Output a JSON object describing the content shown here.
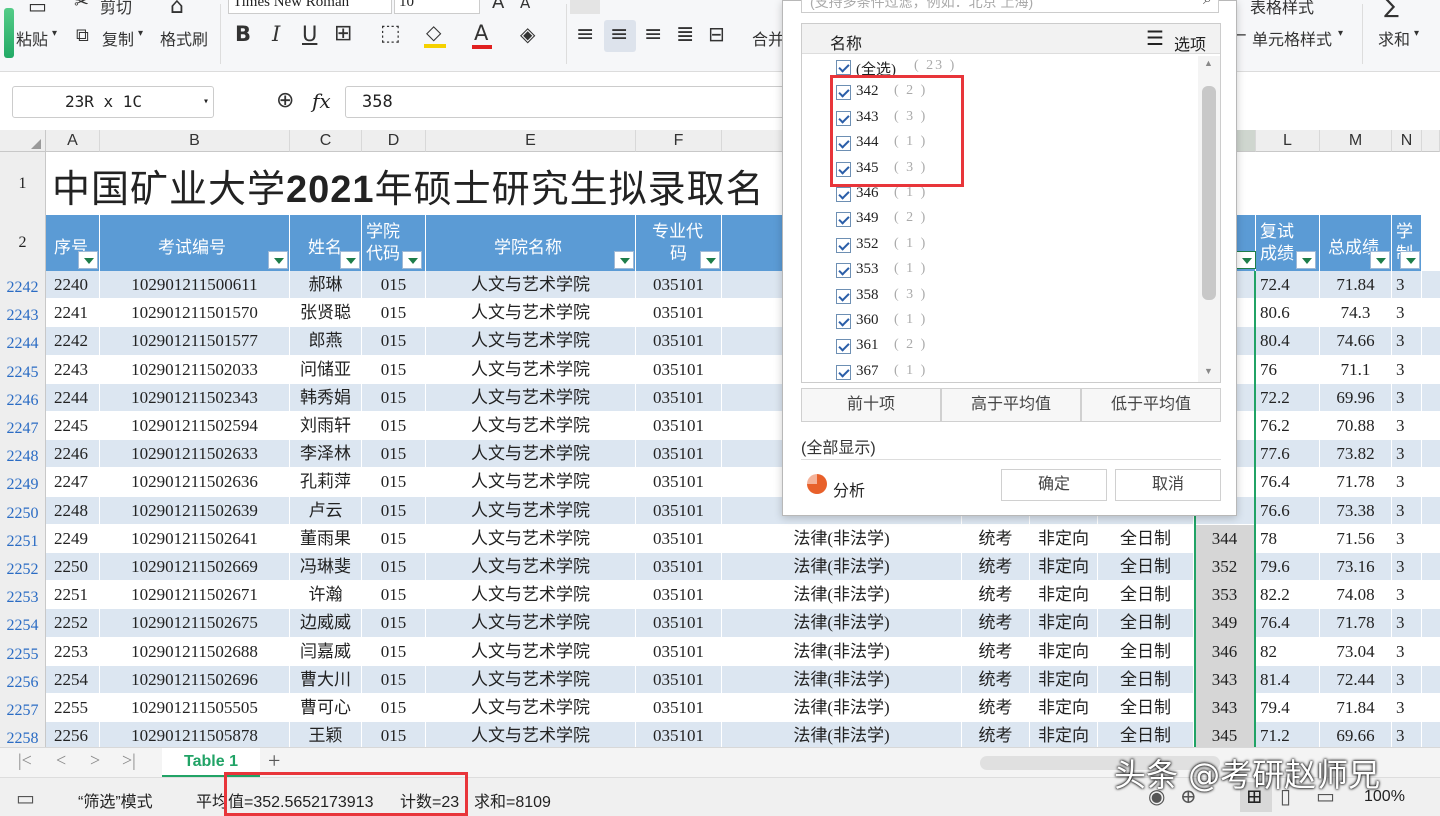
{
  "toolbar": {
    "cut": "剪切",
    "paste": "粘贴",
    "copy": "复制",
    "format_painter": "格式刷",
    "font_name": "Times New Roman",
    "font_size": "10",
    "merge": "合并",
    "table_style": "表格样式",
    "cell_style": "单元格样式",
    "sum": "求和"
  },
  "formula_bar": {
    "name_box": "23R x 1C",
    "fx": "fx",
    "value": "358"
  },
  "columns": [
    "A",
    "B",
    "C",
    "D",
    "E",
    "F",
    "L",
    "M",
    "N"
  ],
  "title": "中国矿业大学2021年硕士研究生拟录取名",
  "title_bold_year": "2021",
  "headers": {
    "seq": "序号",
    "exam_no": "考试编号",
    "name": "姓名",
    "college_code_1": "学院",
    "college_code_2": "代码",
    "college_name": "学院名称",
    "major_code_1": "专业代",
    "major_code_2": "码",
    "retest_1": "复试",
    "retest_2": "成绩",
    "total": "总成绩",
    "xuezhi_1": "学",
    "xuezhi_2": "制"
  },
  "rows": [
    {
      "row": "2242",
      "seq": "2240",
      "exam": "102901211500611",
      "name": "郝琳",
      "code": "015",
      "college": "人文与艺术学院",
      "major": "035101",
      "major_name": "",
      "type": "",
      "dir": "",
      "mode": "",
      "score": "",
      "retest": "72.4",
      "total": "71.84",
      "xz": "3"
    },
    {
      "row": "2243",
      "seq": "2241",
      "exam": "102901211501570",
      "name": "张贤聪",
      "code": "015",
      "college": "人文与艺术学院",
      "major": "035101",
      "major_name": "",
      "type": "",
      "dir": "",
      "mode": "",
      "score": "",
      "retest": "80.6",
      "total": "74.3",
      "xz": "3"
    },
    {
      "row": "2244",
      "seq": "2242",
      "exam": "102901211501577",
      "name": "郎燕",
      "code": "015",
      "college": "人文与艺术学院",
      "major": "035101",
      "major_name": "",
      "type": "",
      "dir": "",
      "mode": "",
      "score": "",
      "retest": "80.4",
      "total": "74.66",
      "xz": "3"
    },
    {
      "row": "2245",
      "seq": "2243",
      "exam": "102901211502033",
      "name": "问储亚",
      "code": "015",
      "college": "人文与艺术学院",
      "major": "035101",
      "major_name": "",
      "type": "",
      "dir": "",
      "mode": "",
      "score": "",
      "retest": "76",
      "total": "71.1",
      "xz": "3"
    },
    {
      "row": "2246",
      "seq": "2244",
      "exam": "102901211502343",
      "name": "韩秀娟",
      "code": "015",
      "college": "人文与艺术学院",
      "major": "035101",
      "major_name": "",
      "type": "",
      "dir": "",
      "mode": "",
      "score": "",
      "retest": "72.2",
      "total": "69.96",
      "xz": "3"
    },
    {
      "row": "2247",
      "seq": "2245",
      "exam": "102901211502594",
      "name": "刘雨轩",
      "code": "015",
      "college": "人文与艺术学院",
      "major": "035101",
      "major_name": "",
      "type": "",
      "dir": "",
      "mode": "",
      "score": "",
      "retest": "76.2",
      "total": "70.88",
      "xz": "3"
    },
    {
      "row": "2248",
      "seq": "2246",
      "exam": "102901211502633",
      "name": "李泽林",
      "code": "015",
      "college": "人文与艺术学院",
      "major": "035101",
      "major_name": "",
      "type": "",
      "dir": "",
      "mode": "",
      "score": "",
      "retest": "77.6",
      "total": "73.82",
      "xz": "3"
    },
    {
      "row": "2249",
      "seq": "2247",
      "exam": "102901211502636",
      "name": "孔莉萍",
      "code": "015",
      "college": "人文与艺术学院",
      "major": "035101",
      "major_name": "",
      "type": "",
      "dir": "",
      "mode": "",
      "score": "",
      "retest": "76.4",
      "total": "71.78",
      "xz": "3"
    },
    {
      "row": "2250",
      "seq": "2248",
      "exam": "102901211502639",
      "name": "卢云",
      "code": "015",
      "college": "人文与艺术学院",
      "major": "035101",
      "major_name": "",
      "type": "",
      "dir": "",
      "mode": "",
      "score": "",
      "retest": "76.6",
      "total": "73.38",
      "xz": "3"
    },
    {
      "row": "2251",
      "seq": "2249",
      "exam": "102901211502641",
      "name": "董雨果",
      "code": "015",
      "college": "人文与艺术学院",
      "major": "035101",
      "major_name": "法律(非法学)",
      "type": "统考",
      "dir": "非定向",
      "mode": "全日制",
      "score": "344",
      "retest": "78",
      "total": "71.56",
      "xz": "3"
    },
    {
      "row": "2252",
      "seq": "2250",
      "exam": "102901211502669",
      "name": "冯琳斐",
      "code": "015",
      "college": "人文与艺术学院",
      "major": "035101",
      "major_name": "法律(非法学)",
      "type": "统考",
      "dir": "非定向",
      "mode": "全日制",
      "score": "352",
      "retest": "79.6",
      "total": "73.16",
      "xz": "3"
    },
    {
      "row": "2253",
      "seq": "2251",
      "exam": "102901211502671",
      "name": "许瀚",
      "code": "015",
      "college": "人文与艺术学院",
      "major": "035101",
      "major_name": "法律(非法学)",
      "type": "统考",
      "dir": "非定向",
      "mode": "全日制",
      "score": "353",
      "retest": "82.2",
      "total": "74.08",
      "xz": "3"
    },
    {
      "row": "2254",
      "seq": "2252",
      "exam": "102901211502675",
      "name": "边威威",
      "code": "015",
      "college": "人文与艺术学院",
      "major": "035101",
      "major_name": "法律(非法学)",
      "type": "统考",
      "dir": "非定向",
      "mode": "全日制",
      "score": "349",
      "retest": "76.4",
      "total": "71.78",
      "xz": "3"
    },
    {
      "row": "2255",
      "seq": "2253",
      "exam": "102901211502688",
      "name": "闫嘉威",
      "code": "015",
      "college": "人文与艺术学院",
      "major": "035101",
      "major_name": "法律(非法学)",
      "type": "统考",
      "dir": "非定向",
      "mode": "全日制",
      "score": "346",
      "retest": "82",
      "total": "73.04",
      "xz": "3"
    },
    {
      "row": "2256",
      "seq": "2254",
      "exam": "102901211502696",
      "name": "曹大川",
      "code": "015",
      "college": "人文与艺术学院",
      "major": "035101",
      "major_name": "法律(非法学)",
      "type": "统考",
      "dir": "非定向",
      "mode": "全日制",
      "score": "343",
      "retest": "81.4",
      "total": "72.44",
      "xz": "3"
    },
    {
      "row": "2257",
      "seq": "2255",
      "exam": "102901211505505",
      "name": "曹可心",
      "code": "015",
      "college": "人文与艺术学院",
      "major": "035101",
      "major_name": "法律(非法学)",
      "type": "统考",
      "dir": "非定向",
      "mode": "全日制",
      "score": "343",
      "retest": "79.4",
      "total": "71.84",
      "xz": "3"
    },
    {
      "row": "2258",
      "seq": "2256",
      "exam": "102901211505878",
      "name": "王颖",
      "code": "015",
      "college": "人文与艺术学院",
      "major": "035101",
      "major_name": "法律(非法学)",
      "type": "统考",
      "dir": "非定向",
      "mode": "全日制",
      "score": "345",
      "retest": "71.2",
      "total": "69.66",
      "xz": "3"
    }
  ],
  "filter_popup": {
    "search_placeholder": "(支持多条件过滤，例如：北京 上海)",
    "list_header": "名称",
    "options_label": "选项",
    "items": [
      {
        "label": "(全选)",
        "count": "( 23 )"
      },
      {
        "label": "342",
        "count": "( 2 )"
      },
      {
        "label": "343",
        "count": "( 3 )"
      },
      {
        "label": "344",
        "count": "( 1 )"
      },
      {
        "label": "345",
        "count": "( 3 )"
      },
      {
        "label": "346",
        "count": "( 1 )"
      },
      {
        "label": "349",
        "count": "( 2 )"
      },
      {
        "label": "352",
        "count": "( 1 )"
      },
      {
        "label": "353",
        "count": "( 1 )"
      },
      {
        "label": "358",
        "count": "( 3 )"
      },
      {
        "label": "360",
        "count": "( 1 )"
      },
      {
        "label": "361",
        "count": "( 2 )"
      },
      {
        "label": "367",
        "count": "( 1 )"
      }
    ],
    "top10": "前十项",
    "above_avg": "高于平均值",
    "below_avg": "低于平均值",
    "show_all": "(全部显示)",
    "analysis": "分析",
    "ok": "确定",
    "cancel": "取消"
  },
  "sheet_tab": "Table 1",
  "status": {
    "mode": "“筛选”模式",
    "avg": "平均值=352.5652173913",
    "count": "计数=23",
    "sum": "求和=8109",
    "zoom": "100%"
  },
  "watermark": "头条 @考研赵师兄",
  "colors": {
    "header_blue": "#5b9bd5",
    "stripe": "#dce6f1",
    "red_box": "#e8353a",
    "green_tab": "#21a366"
  }
}
